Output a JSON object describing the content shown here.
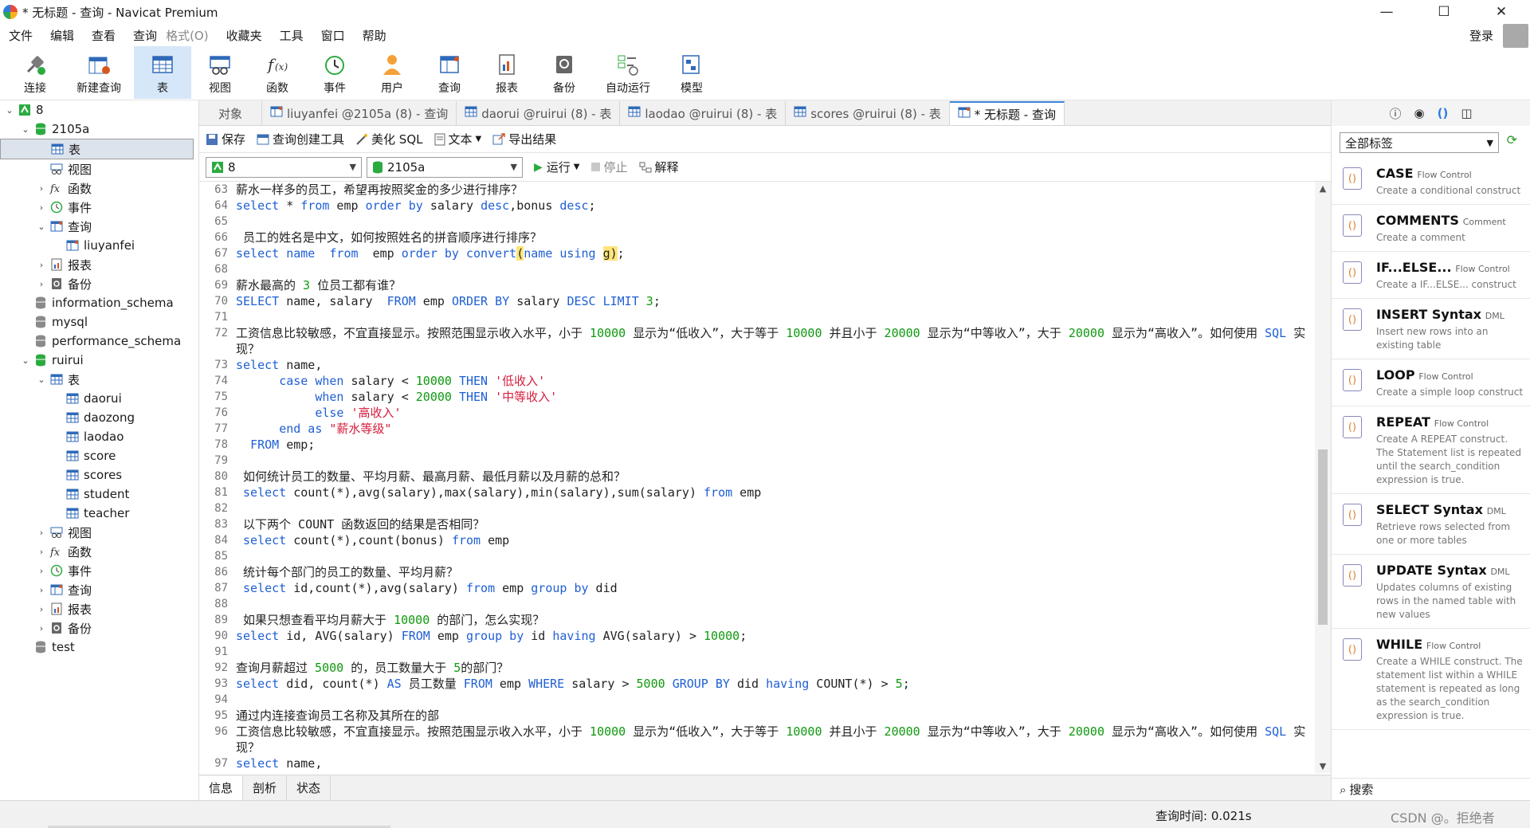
{
  "window": {
    "title": "* 无标题 - 查询 - Navicat Premium",
    "minimize": "—",
    "maximize": "☐",
    "close": "✕"
  },
  "menu": {
    "items": [
      "文件",
      "编辑",
      "查看",
      "查询",
      "格式(O)",
      "收藏夹",
      "工具",
      "窗口",
      "帮助"
    ],
    "login": "登录"
  },
  "toolbar": {
    "items": [
      {
        "label": "连接",
        "icon": "plug-icon"
      },
      {
        "label": "新建查询",
        "icon": "new-query-icon"
      },
      {
        "label": "表",
        "icon": "table-icon",
        "active": true
      },
      {
        "label": "视图",
        "icon": "view-icon"
      },
      {
        "label": "函数",
        "icon": "function-icon"
      },
      {
        "label": "事件",
        "icon": "clock-icon"
      },
      {
        "label": "用户",
        "icon": "user-icon"
      },
      {
        "label": "查询",
        "icon": "query-icon"
      },
      {
        "label": "报表",
        "icon": "report-icon"
      },
      {
        "label": "备份",
        "icon": "backup-icon"
      },
      {
        "label": "自动运行",
        "icon": "schedule-icon"
      },
      {
        "label": "模型",
        "icon": "model-icon"
      }
    ]
  },
  "tree": {
    "items": [
      {
        "label": "8",
        "level": 0,
        "icon": "connection-icon",
        "expanded": true
      },
      {
        "label": "2105a",
        "level": 1,
        "icon": "database-icon",
        "expanded": true
      },
      {
        "label": "表",
        "level": 2,
        "icon": "table-icon",
        "selected": true
      },
      {
        "label": "视图",
        "level": 2,
        "icon": "view-icon"
      },
      {
        "label": "函数",
        "level": 2,
        "icon": "function-icon",
        "collapsed": true
      },
      {
        "label": "事件",
        "level": 2,
        "icon": "clock-icon",
        "collapsed": true
      },
      {
        "label": "查询",
        "level": 2,
        "icon": "query-icon",
        "expanded": true
      },
      {
        "label": "liuyanfei",
        "level": 3,
        "icon": "query-icon"
      },
      {
        "label": "报表",
        "level": 2,
        "icon": "report-icon",
        "collapsed": true
      },
      {
        "label": "备份",
        "level": 2,
        "icon": "backup-icon",
        "collapsed": true
      },
      {
        "label": "information_schema",
        "level": 1,
        "icon": "database-gray-icon"
      },
      {
        "label": "mysql",
        "level": 1,
        "icon": "database-gray-icon"
      },
      {
        "label": "performance_schema",
        "level": 1,
        "icon": "database-gray-icon"
      },
      {
        "label": "ruirui",
        "level": 1,
        "icon": "database-icon",
        "expanded": true
      },
      {
        "label": "表",
        "level": 2,
        "icon": "table-icon",
        "expanded": true
      },
      {
        "label": "daorui",
        "level": 3,
        "icon": "table-icon"
      },
      {
        "label": "daozong",
        "level": 3,
        "icon": "table-icon"
      },
      {
        "label": "laodao",
        "level": 3,
        "icon": "table-icon"
      },
      {
        "label": "score",
        "level": 3,
        "icon": "table-icon"
      },
      {
        "label": "scores",
        "level": 3,
        "icon": "table-icon"
      },
      {
        "label": "student",
        "level": 3,
        "icon": "table-icon"
      },
      {
        "label": "teacher",
        "level": 3,
        "icon": "table-icon"
      },
      {
        "label": "视图",
        "level": 2,
        "icon": "view-icon",
        "collapsed": true
      },
      {
        "label": "函数",
        "level": 2,
        "icon": "function-icon",
        "collapsed": true
      },
      {
        "label": "事件",
        "level": 2,
        "icon": "clock-icon",
        "collapsed": true
      },
      {
        "label": "查询",
        "level": 2,
        "icon": "query-icon",
        "collapsed": true
      },
      {
        "label": "报表",
        "level": 2,
        "icon": "report-icon",
        "collapsed": true
      },
      {
        "label": "备份",
        "level": 2,
        "icon": "backup-icon",
        "collapsed": true
      },
      {
        "label": "test",
        "level": 1,
        "icon": "database-gray-icon"
      }
    ]
  },
  "tabs": [
    {
      "label": "对象",
      "icon": ""
    },
    {
      "label": "liuyanfei @2105a (8) - 查询",
      "icon": "query-icon"
    },
    {
      "label": "daorui @ruirui (8) - 表",
      "icon": "table-icon"
    },
    {
      "label": "laodao @ruirui (8) - 表",
      "icon": "table-icon"
    },
    {
      "label": "scores @ruirui (8) - 表",
      "icon": "table-icon"
    },
    {
      "label": "* 无标题 - 查询",
      "icon": "query-icon",
      "active": true
    }
  ],
  "query_toolbar": {
    "save": "保存",
    "builder": "查询创建工具",
    "beautify": "美化 SQL",
    "text": "文本",
    "export": "导出结果"
  },
  "selectors": {
    "connection": "8",
    "database": "2105a",
    "run": "运行",
    "stop": "停止",
    "explain": "解释"
  },
  "editor": {
    "lines": [
      {
        "no": "63",
        "segs": [
          [
            "t",
            "薪水一样多的员工，希望再按照奖金的多少进行排序？"
          ]
        ]
      },
      {
        "no": "64",
        "segs": [
          [
            "k",
            "select"
          ],
          [
            "t",
            " * "
          ],
          [
            "k",
            "from"
          ],
          [
            "t",
            " emp "
          ],
          [
            "k",
            "order by"
          ],
          [
            "t",
            " salary "
          ],
          [
            "k",
            "desc"
          ],
          [
            "t",
            ",bonus "
          ],
          [
            "k",
            "desc"
          ],
          [
            "t",
            ";"
          ]
        ]
      },
      {
        "no": "65",
        "segs": []
      },
      {
        "no": "66",
        "segs": [
          [
            "t",
            " 员工的姓名是中文，如何按照姓名的拼音顺序进行排序？"
          ]
        ]
      },
      {
        "no": "67",
        "segs": [
          [
            "k",
            "select name  from"
          ],
          [
            "t",
            "  emp "
          ],
          [
            "k",
            "order by convert"
          ],
          [
            "h",
            "("
          ],
          [
            "k",
            "name using"
          ],
          [
            "t",
            " "
          ],
          [
            "h",
            "g"
          ],
          [
            "h",
            ")"
          ],
          [
            "t",
            ";"
          ]
        ]
      },
      {
        "no": "68",
        "segs": []
      },
      {
        "no": "69",
        "segs": [
          [
            "t",
            "薪水最高的 "
          ],
          [
            "n",
            "3"
          ],
          [
            "t",
            " 位员工都有谁？"
          ]
        ]
      },
      {
        "no": "70",
        "segs": [
          [
            "k",
            "SELECT"
          ],
          [
            "t",
            " name, salary  "
          ],
          [
            "k",
            "FROM"
          ],
          [
            "t",
            " emp "
          ],
          [
            "k",
            "ORDER BY"
          ],
          [
            "t",
            " salary "
          ],
          [
            "k",
            "DESC LIMIT"
          ],
          [
            "t",
            " "
          ],
          [
            "n",
            "3"
          ],
          [
            "t",
            ";"
          ]
        ]
      },
      {
        "no": "71",
        "segs": []
      },
      {
        "no": "72",
        "tall": true,
        "segs": [
          [
            "t",
            "工资信息比较敏感，不宜直接显示。按照范围显示收入水平，小于 "
          ],
          [
            "n",
            "10000"
          ],
          [
            "t",
            " 显示为“低收入”，大于等于 "
          ],
          [
            "n",
            "10000"
          ],
          [
            "t",
            " 并且小于 "
          ],
          [
            "n",
            "20000"
          ],
          [
            "t",
            " 显示为“中等收入”，大于 "
          ],
          [
            "n",
            "20000"
          ],
          [
            "t",
            " 显示为“高收入”。如何使用 "
          ],
          [
            "k",
            "SQL"
          ],
          [
            "t",
            " 实现？"
          ]
        ]
      },
      {
        "no": "73",
        "segs": [
          [
            "k",
            "select"
          ],
          [
            "t",
            " name,"
          ]
        ]
      },
      {
        "no": "74",
        "segs": [
          [
            "t",
            "      "
          ],
          [
            "k",
            "case when"
          ],
          [
            "t",
            " salary < "
          ],
          [
            "n",
            "10000"
          ],
          [
            "t",
            " "
          ],
          [
            "k",
            "THEN"
          ],
          [
            "t",
            " "
          ],
          [
            "s",
            "'低收入'"
          ]
        ]
      },
      {
        "no": "75",
        "segs": [
          [
            "t",
            "           "
          ],
          [
            "k",
            "when"
          ],
          [
            "t",
            " salary < "
          ],
          [
            "n",
            "20000"
          ],
          [
            "t",
            " "
          ],
          [
            "k",
            "THEN"
          ],
          [
            "t",
            " "
          ],
          [
            "s",
            "'中等收入'"
          ]
        ]
      },
      {
        "no": "76",
        "segs": [
          [
            "t",
            "           "
          ],
          [
            "k",
            "else"
          ],
          [
            "t",
            " "
          ],
          [
            "s",
            "'高收入'"
          ]
        ]
      },
      {
        "no": "77",
        "segs": [
          [
            "t",
            "      "
          ],
          [
            "k",
            "end as"
          ],
          [
            "t",
            " "
          ],
          [
            "s",
            "\"薪水等级\""
          ]
        ]
      },
      {
        "no": "78",
        "segs": [
          [
            "t",
            "  "
          ],
          [
            "k",
            "FROM"
          ],
          [
            "t",
            " emp;"
          ]
        ]
      },
      {
        "no": "79",
        "segs": []
      },
      {
        "no": "80",
        "segs": [
          [
            "t",
            " 如何统计员工的数量、平均月薪、最高月薪、最低月薪以及月薪的总和？"
          ]
        ]
      },
      {
        "no": "81",
        "segs": [
          [
            "t",
            " "
          ],
          [
            "k",
            "select"
          ],
          [
            "t",
            " count(*),avg(salary),max(salary),min(salary),sum(salary) "
          ],
          [
            "k",
            "from"
          ],
          [
            "t",
            " emp"
          ]
        ]
      },
      {
        "no": "82",
        "segs": []
      },
      {
        "no": "83",
        "segs": [
          [
            "t",
            " 以下两个 COUNT 函数返回的结果是否相同？"
          ]
        ]
      },
      {
        "no": "84",
        "segs": [
          [
            "t",
            " "
          ],
          [
            "k",
            "select"
          ],
          [
            "t",
            " count(*),count(bonus) "
          ],
          [
            "k",
            "from"
          ],
          [
            "t",
            " emp"
          ]
        ]
      },
      {
        "no": "85",
        "segs": []
      },
      {
        "no": "86",
        "segs": [
          [
            "t",
            " 统计每个部门的员工的数量、平均月薪？"
          ]
        ]
      },
      {
        "no": "87",
        "segs": [
          [
            "t",
            " "
          ],
          [
            "k",
            "select"
          ],
          [
            "t",
            " id,count(*),avg(salary) "
          ],
          [
            "k",
            "from"
          ],
          [
            "t",
            " emp "
          ],
          [
            "k",
            "group by"
          ],
          [
            "t",
            " did"
          ]
        ]
      },
      {
        "no": "88",
        "segs": []
      },
      {
        "no": "89",
        "segs": [
          [
            "t",
            " 如果只想查看平均月薪大于 "
          ],
          [
            "n",
            "10000"
          ],
          [
            "t",
            " 的部门，怎么实现？"
          ]
        ]
      },
      {
        "no": "90",
        "segs": [
          [
            "k",
            "select"
          ],
          [
            "t",
            " id, AVG(salary) "
          ],
          [
            "k",
            "FROM"
          ],
          [
            "t",
            " emp "
          ],
          [
            "k",
            "group by"
          ],
          [
            "t",
            " id "
          ],
          [
            "k",
            "having"
          ],
          [
            "t",
            " AVG(salary) > "
          ],
          [
            "n",
            "10000"
          ],
          [
            "t",
            ";"
          ]
        ]
      },
      {
        "no": "91",
        "segs": []
      },
      {
        "no": "92",
        "segs": [
          [
            "t",
            "查询月薪超过 "
          ],
          [
            "n",
            "5000"
          ],
          [
            "t",
            " 的，员工数量大于 "
          ],
          [
            "n",
            "5"
          ],
          [
            "t",
            "的部门？"
          ]
        ]
      },
      {
        "no": "93",
        "segs": [
          [
            "k",
            "select"
          ],
          [
            "t",
            " did, count(*) "
          ],
          [
            "k",
            "AS"
          ],
          [
            "t",
            " 员工数量 "
          ],
          [
            "k",
            "FROM"
          ],
          [
            "t",
            " emp "
          ],
          [
            "k",
            "WHERE"
          ],
          [
            "t",
            " salary > "
          ],
          [
            "n",
            "5000"
          ],
          [
            "t",
            " "
          ],
          [
            "k",
            "GROUP BY"
          ],
          [
            "t",
            " did "
          ],
          [
            "k",
            "having"
          ],
          [
            "t",
            " COUNT(*) > "
          ],
          [
            "n",
            "5"
          ],
          [
            "t",
            ";"
          ]
        ]
      },
      {
        "no": "94",
        "segs": []
      },
      {
        "no": "95",
        "segs": [
          [
            "t",
            "通过内连接查询员工名称及其所在的部"
          ]
        ]
      },
      {
        "no": "96",
        "tall": true,
        "segs": [
          [
            "t",
            "工资信息比较敏感，不宜直接显示。按照范围显示收入水平，小于 "
          ],
          [
            "n",
            "10000"
          ],
          [
            "t",
            " 显示为“低收入”，大于等于 "
          ],
          [
            "n",
            "10000"
          ],
          [
            "t",
            " 并且小于 "
          ],
          [
            "n",
            "20000"
          ],
          [
            "t",
            " 显示为“中等收入”，大于 "
          ],
          [
            "n",
            "20000"
          ],
          [
            "t",
            " 显示为“高收入”。如何使用 "
          ],
          [
            "k",
            "SQL"
          ],
          [
            "t",
            " 实现？"
          ]
        ]
      },
      {
        "no": "97",
        "segs": [
          [
            "k",
            "select"
          ],
          [
            "t",
            " name,"
          ]
        ]
      }
    ]
  },
  "bottom_tabs": [
    "信息",
    "剖析",
    "状态"
  ],
  "right_panel": {
    "tag_select": "全部标签",
    "snippets": [
      {
        "title": "CASE",
        "category": "Flow Control",
        "desc": "Create a conditional construct"
      },
      {
        "title": "COMMENTS",
        "category": "Comment",
        "desc": "Create a comment"
      },
      {
        "title": "IF...ELSE...",
        "category": "Flow Control",
        "desc": "Create a IF...ELSE... construct"
      },
      {
        "title": "INSERT Syntax",
        "category": "DML",
        "desc": "Insert new rows into an existing table"
      },
      {
        "title": "LOOP",
        "category": "Flow Control",
        "desc": "Create a simple loop construct"
      },
      {
        "title": "REPEAT",
        "category": "Flow Control",
        "desc": "Create A REPEAT construct. The Statement list is repeated until the search_condition expression is true."
      },
      {
        "title": "SELECT Syntax",
        "category": "DML",
        "desc": "Retrieve rows selected from one or more tables"
      },
      {
        "title": "UPDATE Syntax",
        "category": "DML",
        "desc": "Updates columns of existing rows in the named table with new values"
      },
      {
        "title": "WHILE",
        "category": "Flow Control",
        "desc": "Create a WHILE construct. The statement list within a WHILE statement is repeated as long as the search_condition expression is true."
      }
    ],
    "search": "搜索"
  },
  "status": {
    "query_time": "查询时间: 0.021s",
    "watermark": "CSDN @。拒绝者"
  },
  "colors": {
    "accent": "#3d86d8",
    "keyword": "#1f5fd4",
    "number": "#0e9a0e",
    "string": "#d61c3c",
    "highlight": "#fde57a"
  }
}
